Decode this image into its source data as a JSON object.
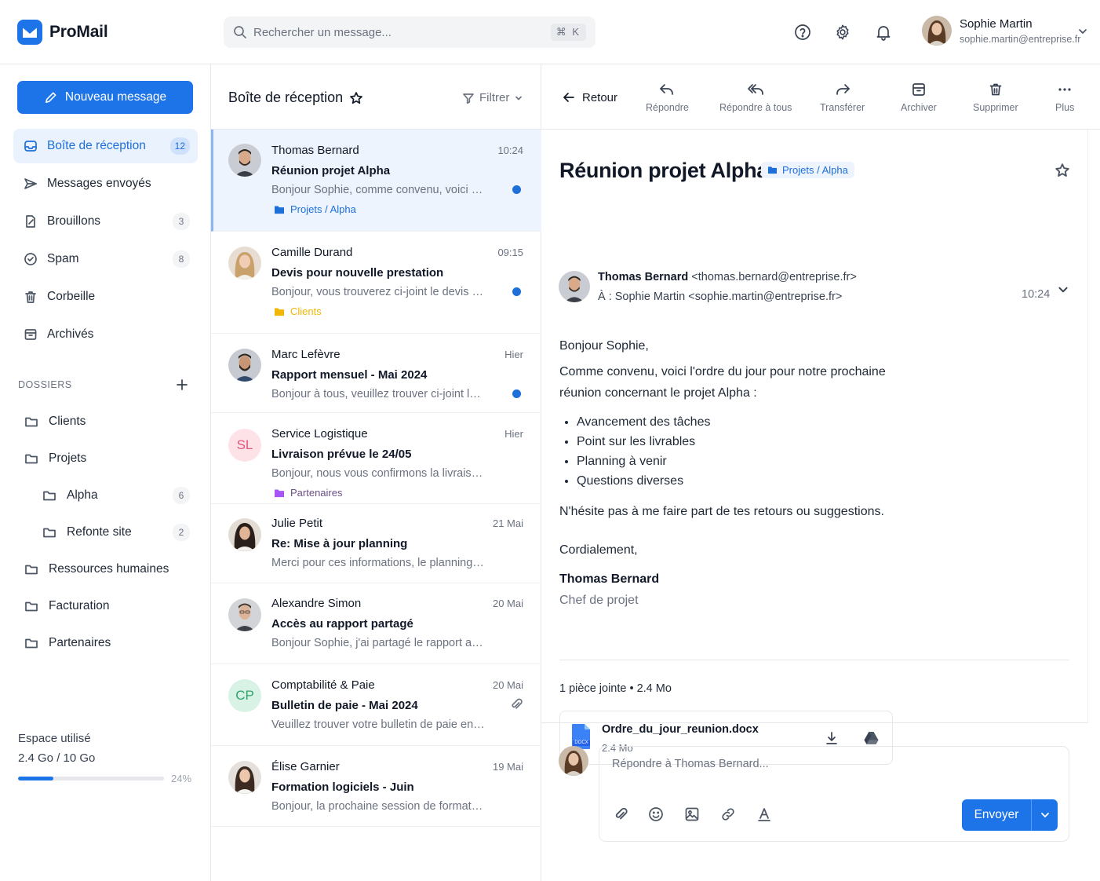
{
  "app": {
    "name": "ProMail"
  },
  "search": {
    "placeholder": "Rechercher un message...",
    "shortcut": "⌘ K"
  },
  "user": {
    "name": "Sophie Martin",
    "email": "sophie.martin@entreprise.fr"
  },
  "compose_label": "Nouveau message",
  "nav": [
    {
      "label": "Boîte de réception",
      "count": "12",
      "icon": "inbox-icon"
    },
    {
      "label": "Messages envoyés",
      "count": "",
      "icon": "send-icon"
    },
    {
      "label": "Brouillons",
      "count": "3",
      "icon": "draft-icon"
    },
    {
      "label": "Spam",
      "count": "8",
      "icon": "spam-icon"
    },
    {
      "label": "Corbeille",
      "count": "",
      "icon": "trash-icon"
    },
    {
      "label": "Archivés",
      "count": "",
      "icon": "archive-icon"
    }
  ],
  "folders_title": "DOSSIERS",
  "folders": [
    {
      "label": "Clients",
      "count": ""
    },
    {
      "label": "Projets",
      "count": ""
    },
    {
      "label": "Alpha",
      "count": "6"
    },
    {
      "label": "Refonte site",
      "count": "2"
    },
    {
      "label": "Ressources humaines",
      "count": ""
    },
    {
      "label": "Facturation",
      "count": ""
    },
    {
      "label": "Partenaires",
      "count": ""
    }
  ],
  "storage": {
    "title": "Espace utilisé",
    "value": "2.4 Go / 10 Go",
    "percent_label": "24%",
    "fraction": 0.24
  },
  "list": {
    "title": "Boîte de réception",
    "filter_label": "Filtrer",
    "messages": [
      {
        "sender": "Thomas Bernard",
        "subject": "Réunion projet Alpha",
        "preview": "Bonjour Sophie, comme convenu, voici l'ordre du jour pour notre prochaine réunion",
        "time": "10:24",
        "unread": true,
        "tag": "Projets / Alpha",
        "tag_color": "#1d6fd9"
      },
      {
        "sender": "Camille Durand",
        "subject": "Devis pour nouvelle prestation",
        "preview": "Bonjour, vous trouverez ci-joint le devis demandé",
        "time": "09:15",
        "unread": true,
        "tag": "Clients",
        "tag_color": "#f2b705"
      },
      {
        "sender": "Marc Lefèvre",
        "subject": "Rapport mensuel - Mai 2024",
        "preview": "Bonjour à tous, veuillez trouver ci-joint le rapport mensuel",
        "time": "Hier",
        "unread": true,
        "tag": "",
        "tag_color": ""
      },
      {
        "sender": "Service Logistique",
        "initials": "SL",
        "subject": "Livraison prévue le 24/05",
        "preview": "Bonjour, nous vous confirmons la livraison de votre commande",
        "time": "Hier",
        "unread": false,
        "tag": "Partenaires",
        "tag_color": "#a855f7"
      },
      {
        "sender": "Julie Petit",
        "subject": "Re: Mise à jour planning",
        "preview": "Merci pour ces informations, le planning est mis à jour",
        "time": "21 Mai",
        "unread": false,
        "tag": "",
        "tag_color": ""
      },
      {
        "sender": "Alexandre Simon",
        "subject": "Accès au rapport partagé",
        "preview": "Bonjour Sophie, j'ai partagé le rapport avec toi",
        "time": "20 Mai",
        "unread": false,
        "tag": "",
        "tag_color": ""
      },
      {
        "sender": "Comptabilité & Paie",
        "initials": "CP",
        "subject": "Bulletin de paie - Mai 2024",
        "preview": "Veuillez trouver votre bulletin de paie en pièce jointe",
        "time": "20 Mai",
        "unread": false,
        "tag": "",
        "tag_color": "",
        "attachment": true
      },
      {
        "sender": "Élise Garnier",
        "subject": "Formation logiciels - Juin",
        "preview": "Bonjour, la prochaine session de formation aura lieu en juin",
        "time": "19 Mai",
        "unread": false,
        "tag": "",
        "tag_color": ""
      }
    ]
  },
  "toolbar": {
    "back": "Retour",
    "actions": [
      {
        "label": "Répondre",
        "icon": "reply-icon"
      },
      {
        "label": "Répondre à tous",
        "icon": "reply-all-icon"
      },
      {
        "label": "Transférer",
        "icon": "forward-icon"
      },
      {
        "label": "Archiver",
        "icon": "archive-icon"
      },
      {
        "label": "Supprimer",
        "icon": "trash-icon"
      },
      {
        "label": "Plus",
        "icon": "more-icon"
      }
    ]
  },
  "email": {
    "subject": "Réunion projet Alpha",
    "tag": "Projets / Alpha",
    "from_name": "Thomas Bernard",
    "from_addr": "<thomas.bernard@entreprise.fr>",
    "to": "À : Sophie Martin <sophie.martin@entreprise.fr>",
    "time": "10:24",
    "greeting": "Bonjour Sophie,",
    "intro": "Comme convenu, voici l'ordre du jour pour notre prochaine réunion concernant le projet Alpha :",
    "points": [
      "Avancement des tâches",
      "Point sur les livrables",
      "Planning à venir",
      "Questions diverses"
    ],
    "closing_line": "N'hésite pas à me faire part de tes retours ou suggestions.",
    "signoff": "Cordialement,",
    "sign_name": "Thomas Bernard",
    "sign_role": "Chef de projet",
    "attachments_summary": "1 pièce jointe • 2.4 Mo",
    "attachment": {
      "name": "Ordre_du_jour_reunion.docx",
      "size": "2.4 Mo",
      "badge": "DOCX"
    }
  },
  "reply": {
    "placeholder": "Répondre à Thomas Bernard...",
    "send_label": "Envoyer"
  },
  "colors": {
    "accent": "#1d74e8",
    "active_bg": "#eaf2fd",
    "unread_dot": "#1d6fd9"
  }
}
